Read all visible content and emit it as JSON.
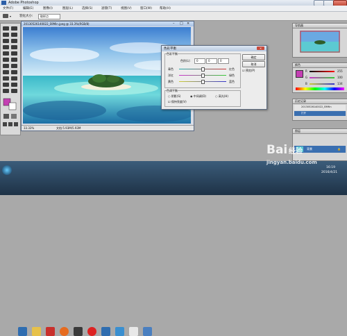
{
  "app": {
    "title": "Adobe Photoshop"
  },
  "menu": [
    "文件(F)",
    "编辑(E)",
    "图像(I)",
    "图层(L)",
    "选择(S)",
    "滤镜(T)",
    "视图(V)",
    "窗口(W)",
    "帮助(H)"
  ],
  "options_bar": {
    "feather_label": "羽化大小:",
    "feather_value": "取样点",
    "mode_value": ""
  },
  "document": {
    "title": "20130526140022_S9Min.jpeg @ 33.3%(RGB/8)",
    "zoom": "33.33%",
    "doc_info": "文档:5.93M/5.93M"
  },
  "dialog": {
    "title": "色彩平衡",
    "group_balance": "色彩平衡",
    "levels_label": "色阶(L):",
    "levels": [
      "0",
      "0",
      "0"
    ],
    "sliders": [
      {
        "left": "青色",
        "right": "红色",
        "value": 0.5
      },
      {
        "left": "洋红",
        "right": "绿色",
        "value": 0.5
      },
      {
        "left": "黄色",
        "right": "蓝色",
        "value": 0.5
      }
    ],
    "group_tone": "色调平衡",
    "tone_options": [
      "阴影(S)",
      "中间调(D)",
      "高光(H)"
    ],
    "preserve_label": "保持亮度(V)",
    "ok": "确定",
    "cancel": "取消",
    "preview": "预览(P)"
  },
  "panels": {
    "navigator": "导航器",
    "color": {
      "title": "颜色",
      "r": "255",
      "g": "100",
      "b": "134",
      "r_label": "R",
      "g_label": "G",
      "b_label": "B"
    },
    "history": {
      "title": "历史记录",
      "item": "20130526140022_S9Min",
      "step": "打开"
    },
    "layers": {
      "title": "图层",
      "layer_name": "背景"
    }
  },
  "taskbar": {
    "time": "16:19",
    "date": "2016/4/21"
  },
  "watermark": {
    "brand": "Bai",
    "brand2": "经验",
    "url": "jingyan.baidu.com"
  }
}
